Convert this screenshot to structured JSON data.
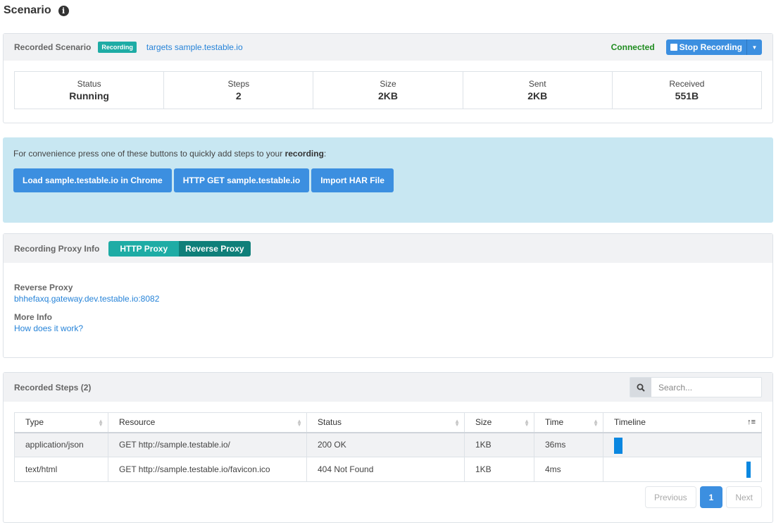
{
  "page": {
    "title": "Scenario"
  },
  "recorded_scenario": {
    "title": "Recorded Scenario",
    "badge": "Recording",
    "target_link": "targets sample.testable.io",
    "connection_status": "Connected",
    "stop_button": "Stop Recording",
    "stats": [
      {
        "label": "Status",
        "value": "Running"
      },
      {
        "label": "Steps",
        "value": "2"
      },
      {
        "label": "Size",
        "value": "2KB"
      },
      {
        "label": "Sent",
        "value": "2KB"
      },
      {
        "label": "Received",
        "value": "551B"
      }
    ]
  },
  "quick_add": {
    "text_prefix": "For convenience press one of these buttons to quickly add steps to your ",
    "text_bold": "recording",
    "text_suffix": ":",
    "buttons": [
      "Load sample.testable.io in Chrome",
      "HTTP GET sample.testable.io",
      "Import HAR File"
    ]
  },
  "proxy_info": {
    "title": "Recording Proxy Info",
    "tabs": [
      "HTTP Proxy",
      "Reverse Proxy"
    ],
    "active_tab": "Reverse Proxy",
    "reverse_proxy_label": "Reverse Proxy",
    "reverse_proxy_value": "bhhefaxq.gateway.dev.testable.io:8082",
    "more_info_label": "More Info",
    "more_info_link": "How does it work?"
  },
  "recorded_steps": {
    "title": "Recorded Steps (2)",
    "search_placeholder": "Search...",
    "columns": [
      "Type",
      "Resource",
      "Status",
      "Size",
      "Time",
      "Timeline"
    ],
    "rows": [
      {
        "type": "application/json",
        "resource": "GET http://sample.testable.io/",
        "status": "200 OK",
        "size": "1KB",
        "time": "36ms",
        "timeline_start": 0.0,
        "timeline_fraction": 0.06
      },
      {
        "type": "text/html",
        "resource": "GET http://sample.testable.io/favicon.ico",
        "status": "404 Not Found",
        "size": "1KB",
        "time": "4ms",
        "timeline_start": 0.97,
        "timeline_fraction": 0.03
      }
    ],
    "pagination": {
      "previous": "Previous",
      "current": "1",
      "next": "Next"
    }
  },
  "colors": {
    "primary": "#3c8fe0",
    "teal": "#1eaca5",
    "teal_dark": "#0f7f79",
    "connected": "#1f8c1f",
    "alert_bg": "#c8e7f2",
    "timeline_bar": "#0a87e0"
  }
}
